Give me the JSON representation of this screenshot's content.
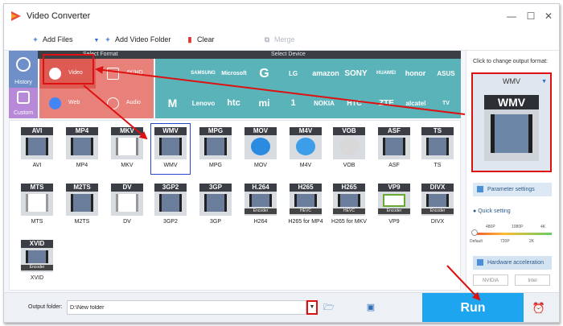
{
  "app": {
    "title": "Video Converter",
    "window_controls": [
      "—",
      "☐",
      "✕"
    ]
  },
  "toolbar": {
    "add_files": "Add Files",
    "add_video_folder": "Add Video Folder",
    "clear": "Clear",
    "merge": "Merge"
  },
  "format_panel": {
    "select_format": "Select Format",
    "select_device": "Select Device",
    "sidebar": [
      {
        "label": "History"
      },
      {
        "label": "Custom"
      }
    ],
    "formats": [
      {
        "label": "Video",
        "icon": "video-icon"
      },
      {
        "label": "4K/HD",
        "icon": "4k-icon"
      },
      {
        "label": "Web",
        "icon": "web-icon"
      },
      {
        "label": "Audio",
        "icon": "audio-icon"
      }
    ],
    "devices_row1": [
      "",
      "SAMSUNG",
      "Microsoft",
      "G",
      "LG",
      "amazon",
      "SONY",
      "HUAWEI",
      "honor",
      "ASUS"
    ],
    "devices_row2": [
      "M",
      "Lenovo",
      "htc",
      "mi",
      "1",
      "NOKIA",
      "HTC",
      "ZTE",
      "alcatel",
      "TV"
    ]
  },
  "grid": {
    "row1": [
      {
        "label": "AVI",
        "name": "AVI",
        "sub": ""
      },
      {
        "label": "MP4",
        "name": "MP4",
        "sub": ""
      },
      {
        "label": "MKV",
        "name": "MKV",
        "sub": ""
      },
      {
        "label": "WMV",
        "name": "WMV",
        "sub": ""
      },
      {
        "label": "MPG",
        "name": "MPG",
        "sub": ""
      },
      {
        "label": "MOV",
        "name": "MOV",
        "sub": ""
      },
      {
        "label": "M4V",
        "name": "M4V",
        "sub": ""
      },
      {
        "label": "VOB",
        "name": "VOB",
        "sub": ""
      },
      {
        "label": "ASF",
        "name": "ASF",
        "sub": ""
      },
      {
        "label": "TS",
        "name": "TS",
        "sub": ""
      }
    ],
    "row2": [
      {
        "label": "MTS",
        "name": "MTS",
        "sub": ""
      },
      {
        "label": "M2TS",
        "name": "M2TS",
        "sub": ""
      },
      {
        "label": "DV",
        "name": "DV",
        "sub": ""
      },
      {
        "label": "3GP2",
        "name": "3GP2",
        "sub": ""
      },
      {
        "label": "3GP",
        "name": "3GP",
        "sub": ""
      },
      {
        "label": "H.264",
        "name": "H264",
        "sub": "Encoder"
      },
      {
        "label": "H265",
        "name": "H265 for MP4",
        "sub": "HEVC"
      },
      {
        "label": "H265",
        "name": "H265 for MKV",
        "sub": "HEVC"
      },
      {
        "label": "VP9",
        "name": "VP9",
        "sub": "Encoder"
      },
      {
        "label": "DIVX",
        "name": "DIVX",
        "sub": "Encoder"
      }
    ],
    "row3": [
      {
        "label": "XVID",
        "name": "XVID",
        "sub": "Encoder"
      }
    ],
    "selected": "WMV"
  },
  "right_panel": {
    "hint": "Click to change output format:",
    "output_format": "WMV",
    "parameter_settings": "Parameter settings",
    "quick_setting": "Quick setting",
    "ticks_top": [
      "480P",
      "1080P",
      "4K"
    ],
    "ticks_bottom": [
      "Default",
      "720P",
      "2K"
    ],
    "hardware_acceleration": "Hardware acceleration",
    "chips": [
      "NVIDIA",
      "Intel"
    ]
  },
  "bottom": {
    "output_folder_label": "Output folder:",
    "output_folder_value": "D:\\New folder",
    "run": "Run"
  }
}
